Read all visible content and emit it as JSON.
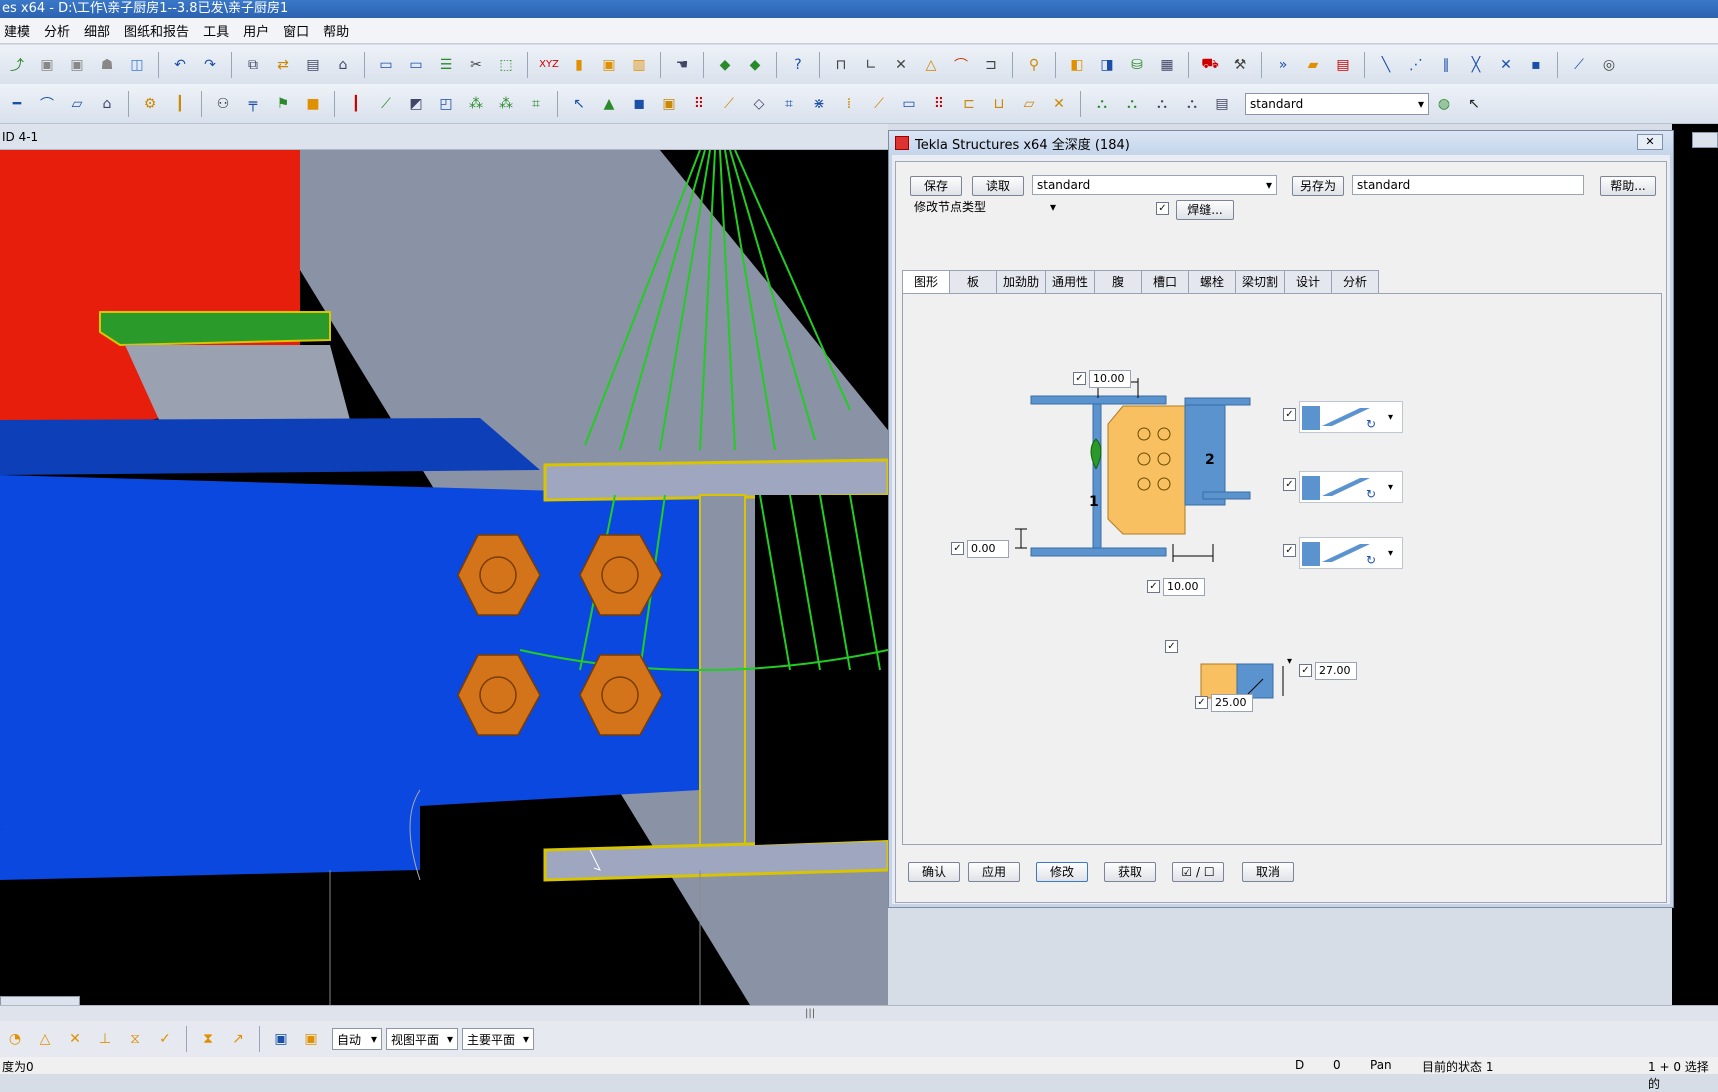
{
  "window": {
    "title": "es x64 - D:\\工作\\亲子厨房1--3.8已发\\亲子厨房1"
  },
  "menu": [
    "建模",
    "分析",
    "细部",
    "图纸和报告",
    "工具",
    "用户",
    "窗口",
    "帮助"
  ],
  "toolbar": {
    "profile_combo": "standard"
  },
  "viewport": {
    "label": "ID 4-1"
  },
  "dialog": {
    "title": "Tekla Structures x64  全深度 (184)",
    "close": "✕",
    "save": "保存",
    "load": "读取",
    "load_value": "standard",
    "save_as": "另存为",
    "save_as_value": "standard",
    "help": "帮助...",
    "node_type": "修改节点类型",
    "weld": "焊缝...",
    "tabs": [
      "图形",
      "板",
      "加劲肋",
      "通用性",
      "腹",
      "槽口",
      "螺栓",
      "梁切割",
      "设计",
      "分析"
    ],
    "fields": {
      "top_gap": "10.00",
      "left_offset": "0.00",
      "bottom_gap": "10.00",
      "chamfer_right": "27.00",
      "chamfer_bottom": "25.00"
    },
    "labels": {
      "part1": "1",
      "part2": "2"
    },
    "buttons": {
      "ok": "确认",
      "apply": "应用",
      "modify": "修改",
      "get": "获取",
      "toggle": "☑ / ☐",
      "cancel": "取消"
    }
  },
  "bottom": {
    "auto": "自动",
    "view_plane": "视图平面",
    "main_plane": "主要平面"
  },
  "status": {
    "left": "度为0",
    "d": "D",
    "zero": "0",
    "pan": "Pan",
    "state": "目前的状态 1",
    "selected": "1 + 0 选择的"
  },
  "colors": {
    "accent": "#2c63b0",
    "blue_part": "#0a48e0",
    "red_part": "#e81e0c",
    "gray_part": "#8a93a6",
    "bolt": "#d4741a",
    "plate": "#f8c060",
    "steel": "#5b93cf"
  }
}
